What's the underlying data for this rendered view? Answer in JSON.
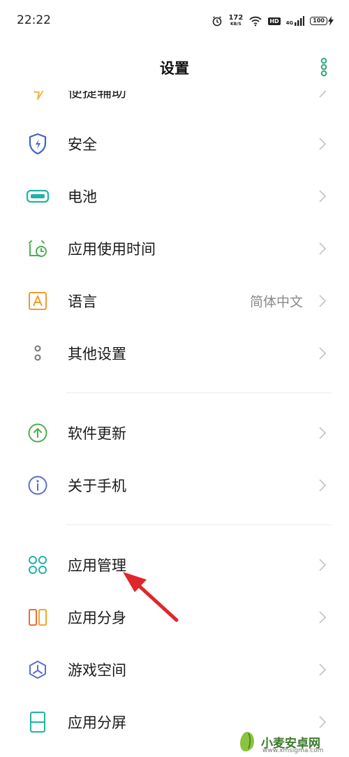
{
  "status": {
    "time": "22:22",
    "speed_value": "172",
    "speed_unit": "KB/S",
    "hd": "HD",
    "network": "4G",
    "battery": "100"
  },
  "header": {
    "title": "设置"
  },
  "items": [
    {
      "label": "便捷辅助",
      "icon": "accessibility-icon",
      "color": "#f0b64a"
    },
    {
      "label": "安全",
      "icon": "shield-icon",
      "color": "#3e66c6"
    },
    {
      "label": "电池",
      "icon": "battery-icon",
      "color": "#22b3a3"
    },
    {
      "label": "应用使用时间",
      "icon": "alarm-icon",
      "color": "#4caf50"
    },
    {
      "label": "语言",
      "icon": "language-icon",
      "color": "#f39a2b",
      "value": "简体中文"
    },
    {
      "label": "其他设置",
      "icon": "more-settings-icon",
      "color": "#777777"
    },
    {
      "label": "软件更新",
      "icon": "update-icon",
      "color": "#4caf50"
    },
    {
      "label": "关于手机",
      "icon": "info-icon",
      "color": "#5a6ed0"
    },
    {
      "label": "应用管理",
      "icon": "app-management-icon",
      "color": "#22b3a3"
    },
    {
      "label": "应用分身",
      "icon": "app-clone-icon",
      "color": "#f06a3b"
    },
    {
      "label": "游戏空间",
      "icon": "game-space-icon",
      "color": "#5a6ed0"
    },
    {
      "label": "应用分屏",
      "icon": "split-screen-icon",
      "color": "#22b3a3"
    }
  ],
  "watermark": {
    "text": "小麦安卓网",
    "url": "www.xmsigma.com"
  },
  "colors": {
    "accent_green": "#2aa876",
    "arrow_red": "#e0262a"
  }
}
